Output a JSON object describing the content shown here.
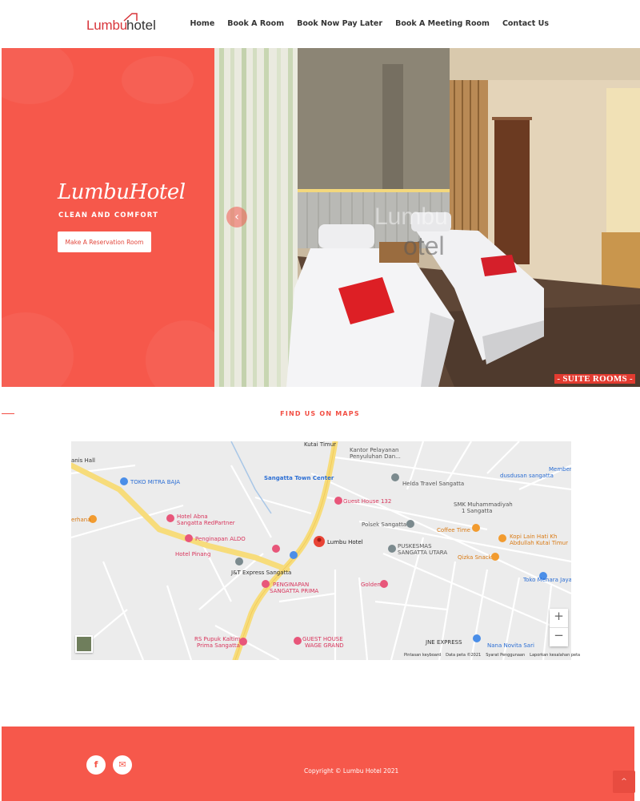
{
  "header": {
    "logo_word1": "Lumbu",
    "logo_word2": "hotel",
    "nav": [
      {
        "label": "Home"
      },
      {
        "label": "Book A Room"
      },
      {
        "label": "Book Now Pay Later"
      },
      {
        "label": "Book A Meeting Room"
      },
      {
        "label": "Contact Us"
      }
    ]
  },
  "hero": {
    "title": "LumbuHotel",
    "subtitle": "CLEAN AND COMFORT",
    "button_label": "Make A Reservation Room",
    "photo_label": "- SUITE ROOMS -",
    "prev_icon": "chevron-left-icon"
  },
  "map_section": {
    "heading": "FIND US ON MAPS",
    "labels": {
      "kutai_timur": "Kutai Timur",
      "kantor": "Kantor Pelayanan",
      "kantor2": "Penyuluhan Dan...",
      "anis_hall": "anis Hall",
      "toko_mitra": "TOKO MITRA BAJA",
      "sangatta_town": "Sangatta Town Center",
      "helda": "Helda Travel Sangatta",
      "guest_house_132": "Guest House 132",
      "smk1": "SMK Muhammadiyah",
      "smk2": "1 Sangatta",
      "member1": "Member",
      "member2": "dusdusan sangatta",
      "herhana": "erhana",
      "abna1": "Hotel Abna",
      "abna2": "Sangatta RedPartner",
      "polsek": "Polsek Sangatta",
      "coffee": "Coffee Time",
      "kopi1": "Kopi Lain Hati Kh",
      "kopi2": "Abdullah Kutai Timur",
      "aldo": "Penginapan ALDO",
      "lumbu": "Lumbu Hotel",
      "puskesmas1": "PUSKESMAS",
      "puskesmas2": "SANGATTA UTARA",
      "pinang": "Hotel Pinang",
      "qizka": "Qizka Snack",
      "jnt": "J&T Express Sangatta",
      "menara": "Toko Menara Jaya",
      "golden": "Golden",
      "penginapan1": "PENGINAPAN",
      "penginapan2": "SANGATTA PRIMA",
      "rs1": "RS Pupuk Kaltim",
      "rs2": "Prima Sangatta",
      "gh1": "GUEST HOUSE",
      "gh2": "WAGE GRAND",
      "jne": "JNE EXPRESS",
      "nana": "Nana Novita Sari"
    },
    "footer_links": [
      "Pintasan keyboard",
      "Data peta ©2021",
      "Syarat Penggunaan",
      "Laporkan kesalahan peta"
    ],
    "zoom_in": "+",
    "zoom_out": "−"
  },
  "footer": {
    "copyright": "Copyright © Lumbu Hotel 2021",
    "facebook_icon": "f",
    "email_icon": "✉",
    "to_top_icon": "^"
  },
  "colors": {
    "brand_coral": "#f6584b",
    "brand_red": "#d8353a"
  }
}
